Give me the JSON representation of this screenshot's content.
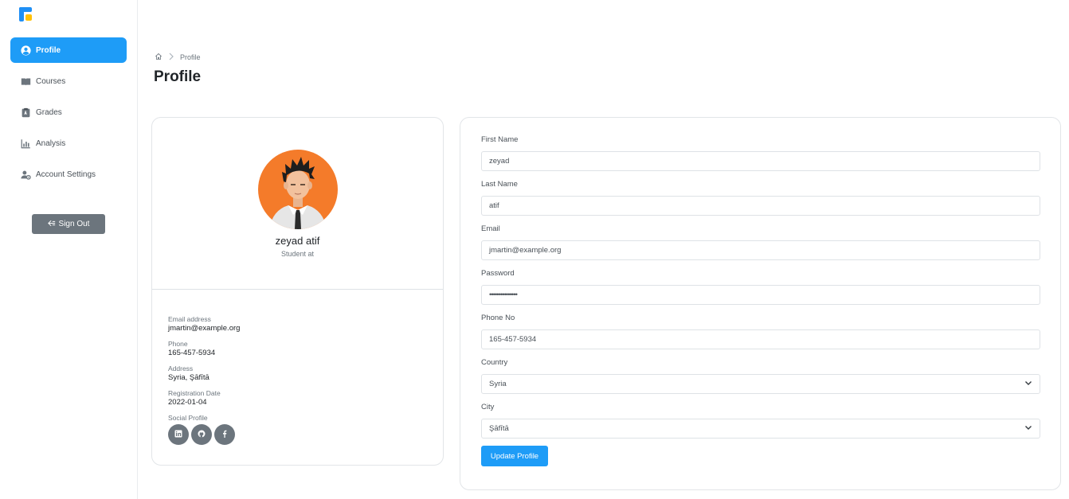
{
  "sidebar": {
    "items": [
      {
        "label": "Profile",
        "icon": "user-circle-icon",
        "active": true
      },
      {
        "label": "Courses",
        "icon": "book-open-icon",
        "active": false
      },
      {
        "label": "Grades",
        "icon": "grades-icon",
        "active": false
      },
      {
        "label": "Analysis",
        "icon": "bar-chart-icon",
        "active": false
      },
      {
        "label": "Account Settings",
        "icon": "user-gear-icon",
        "active": false
      }
    ],
    "sign_out_label": "Sign Out"
  },
  "breadcrumb": {
    "current": "Profile"
  },
  "page": {
    "title": "Profile"
  },
  "profile_card": {
    "name": "zeyad atif",
    "subtitle": "Student at",
    "details": [
      {
        "label": "Email address",
        "value": "jmartin@example.org"
      },
      {
        "label": "Phone",
        "value": "165-457-5934"
      },
      {
        "label": "Address",
        "value": "Syria, Şāfītā"
      },
      {
        "label": "Registration Date",
        "value": "2022-01-04"
      }
    ],
    "social_label": "Social Profile",
    "socials": [
      "linkedin-icon",
      "github-icon",
      "facebook-icon"
    ]
  },
  "form": {
    "first_name": {
      "label": "First Name",
      "value": "zeyad"
    },
    "last_name": {
      "label": "Last Name",
      "value": "atif"
    },
    "email": {
      "label": "Email",
      "value": "jmartin@example.org"
    },
    "password": {
      "label": "Password",
      "value": "•••••••••••••••"
    },
    "phone": {
      "label": "Phone No",
      "value": "165-457-5934"
    },
    "country": {
      "label": "Country",
      "value": "Syria"
    },
    "city": {
      "label": "City",
      "value": "Şāfītā"
    },
    "submit_label": "Update Profile"
  },
  "colors": {
    "accent": "#1e9cf7",
    "avatar_bg": "#f47b2a",
    "sign_out_bg": "#6c757d"
  }
}
